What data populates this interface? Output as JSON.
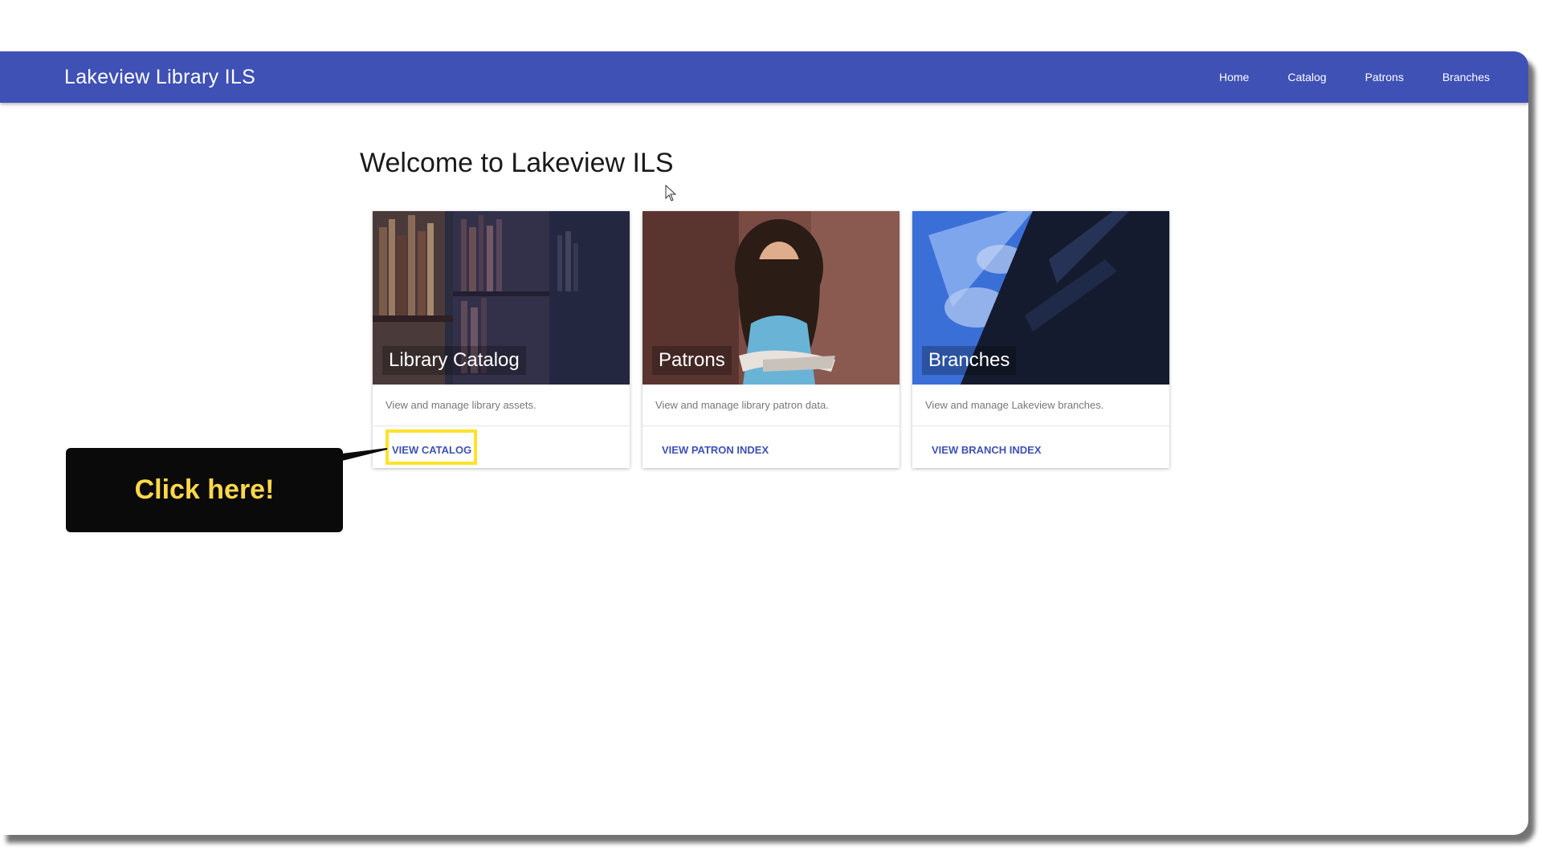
{
  "navbar": {
    "brand": "Lakeview Library ILS",
    "links": [
      "Home",
      "Catalog",
      "Patrons",
      "Branches"
    ]
  },
  "main": {
    "title": "Welcome to Lakeview ILS"
  },
  "cards": [
    {
      "title": "Library Catalog",
      "description": "View and manage library assets.",
      "action": "VIEW CATALOG",
      "image": "bookshelf-photo"
    },
    {
      "title": "Patrons",
      "description": "View and manage library patron data.",
      "action": "VIEW PATRON INDEX",
      "image": "reading-woman-photo"
    },
    {
      "title": "Branches",
      "description": "View and manage Lakeview branches.",
      "action": "VIEW BRANCH INDEX",
      "image": "building-glass-photo"
    }
  ],
  "callout": {
    "text": "Click here!"
  },
  "colors": {
    "primary": "#3f51b5",
    "highlight": "#ffe22b",
    "callout_bg": "#0a0a0a",
    "callout_text": "#ffd84a"
  }
}
